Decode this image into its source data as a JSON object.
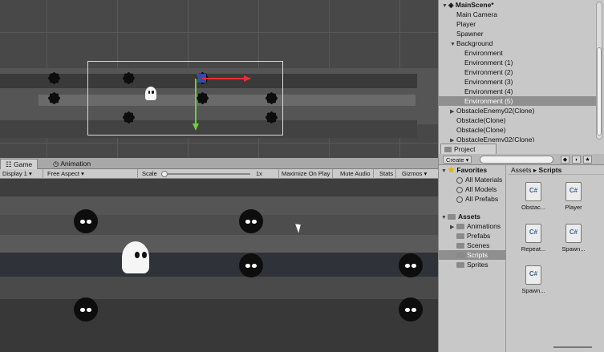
{
  "hierarchy": {
    "scene_name": "MainScene*",
    "items": [
      {
        "label": "Main Camera",
        "indent": 1,
        "arrow": ""
      },
      {
        "label": "Player",
        "indent": 1,
        "arrow": ""
      },
      {
        "label": "Spawner",
        "indent": 1,
        "arrow": ""
      },
      {
        "label": "Background",
        "indent": 1,
        "arrow": "▼"
      },
      {
        "label": "Environment",
        "indent": 2,
        "arrow": ""
      },
      {
        "label": "Environment (1)",
        "indent": 2,
        "arrow": ""
      },
      {
        "label": "Environment (2)",
        "indent": 2,
        "arrow": ""
      },
      {
        "label": "Environment (3)",
        "indent": 2,
        "arrow": ""
      },
      {
        "label": "Environment (4)",
        "indent": 2,
        "arrow": ""
      },
      {
        "label": "Environment (5)",
        "indent": 2,
        "arrow": "",
        "selected": true
      },
      {
        "label": "ObstacleEnemy02(Clone)",
        "indent": 1,
        "arrow": "▶"
      },
      {
        "label": "Obstacle(Clone)",
        "indent": 1,
        "arrow": ""
      },
      {
        "label": "Obstacle(Clone)",
        "indent": 1,
        "arrow": ""
      },
      {
        "label": "ObstacleEnemy02(Clone)",
        "indent": 1,
        "arrow": "▶"
      }
    ]
  },
  "game": {
    "tab_game": "Game",
    "tab_animation": "Animation",
    "display": "Display 1",
    "aspect": "Free Aspect",
    "scale_label": "Scale",
    "scale_value": "1x",
    "maximize": "Maximize On Play",
    "mute": "Mute Audio",
    "stats": "Stats",
    "gizmos": "Gizmos"
  },
  "project": {
    "tab": "Project",
    "create": "Create",
    "favorites_label": "Favorites",
    "favorites": [
      "All Materials",
      "All Models",
      "All Prefabs"
    ],
    "assets_label": "Assets",
    "folders": [
      "Animations",
      "Prefabs",
      "Scenes",
      "Scripts",
      "Sprites"
    ],
    "selected_folder": "Scripts",
    "breadcrumb_root": "Assets",
    "breadcrumb_sep": "▸",
    "breadcrumb_current": "Scripts",
    "files": [
      {
        "name": "Obstac...",
        "type": "C#"
      },
      {
        "name": "Player",
        "type": "C#"
      },
      {
        "name": "Repeat...",
        "type": "C#"
      },
      {
        "name": "Spawn...",
        "type": "C#"
      },
      {
        "name": "Spawn...",
        "type": "C#"
      }
    ]
  },
  "colors": {
    "scene_bg": "#484848",
    "game_bg": "#3e3e3e",
    "panel_bg": "#c8c8c8",
    "selection": "#8f8f8f",
    "gizmo_x": "#e53030",
    "gizmo_y": "#6ccf3a",
    "gizmo_center": "#3a5fd0"
  }
}
